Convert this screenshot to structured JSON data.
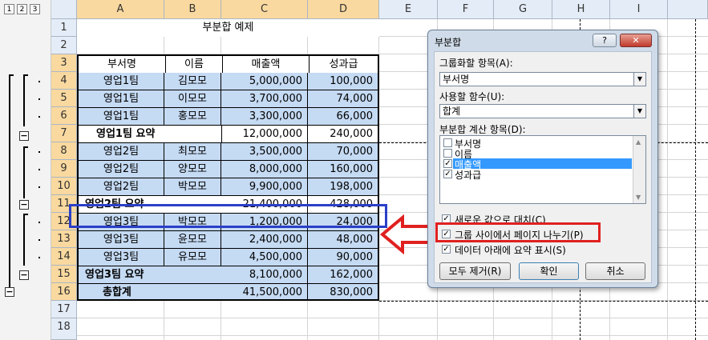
{
  "outline": {
    "levels": [
      "1",
      "2",
      "3"
    ],
    "collapse_symbol": "−"
  },
  "columns": [
    "A",
    "B",
    "C",
    "D",
    "E",
    "F",
    "G",
    "H",
    "I"
  ],
  "rows": [
    "1",
    "2",
    "3",
    "4",
    "5",
    "6",
    "7",
    "8",
    "9",
    "10",
    "11",
    "12",
    "13",
    "14",
    "15",
    "16",
    "17",
    "18"
  ],
  "sheet": {
    "title": "부분합 예제",
    "headers": [
      "부서명",
      "이름",
      "매출액",
      "성과급"
    ],
    "data": [
      [
        "영업1팀",
        "김모모",
        "5,000,000",
        "100,000"
      ],
      [
        "영업1팀",
        "이모모",
        "3,700,000",
        "74,000"
      ],
      [
        "영업1팀",
        "홍모모",
        "3,300,000",
        "66,000"
      ],
      [
        "영업1팀 요약",
        "",
        "12,000,000",
        "240,000"
      ],
      [
        "영업2팀",
        "최모모",
        "3,500,000",
        "70,000"
      ],
      [
        "영업2팀",
        "양모모",
        "8,000,000",
        "160,000"
      ],
      [
        "영업2팀",
        "박모모",
        "9,900,000",
        "198,000"
      ],
      [
        "영업2팀 요약",
        "",
        "21,400,000",
        "428,000"
      ],
      [
        "영업3팀",
        "박모모",
        "1,200,000",
        "24,000"
      ],
      [
        "영업3팀",
        "윤모모",
        "2,400,000",
        "48,000"
      ],
      [
        "영업3팀",
        "유모모",
        "4,500,000",
        "90,000"
      ],
      [
        "영업3팀 요약",
        "",
        "8,100,000",
        "162,000"
      ],
      [
        "총합계",
        "",
        "41,500,000",
        "830,000"
      ]
    ]
  },
  "dialog": {
    "title": "부분합",
    "help": "?",
    "close": "✕",
    "group_by_label": "그룹화할 항목(A):",
    "group_by_value": "부서명",
    "function_label": "사용할 함수(U):",
    "function_value": "합계",
    "fields_label": "부분합 계산 항목(D):",
    "fields": [
      {
        "label": "부서명",
        "checked": false
      },
      {
        "label": "이름",
        "checked": false
      },
      {
        "label": "매출액",
        "checked": true
      },
      {
        "label": "성과급",
        "checked": true
      }
    ],
    "options": [
      {
        "label": "새로운 값으로 대치(C)",
        "checked": true
      },
      {
        "label": "그룹 사이에서 페이지 나누기(P)",
        "checked": true
      },
      {
        "label": "데이터 아래에 요약 표시(S)",
        "checked": true
      }
    ],
    "buttons": {
      "remove_all": "모두 제거(R)",
      "ok": "확인",
      "cancel": "취소"
    }
  },
  "colors": {
    "selection": "#c5daf3",
    "highlight_red": "#e02020",
    "highlight_blue": "#2a3fc8"
  }
}
